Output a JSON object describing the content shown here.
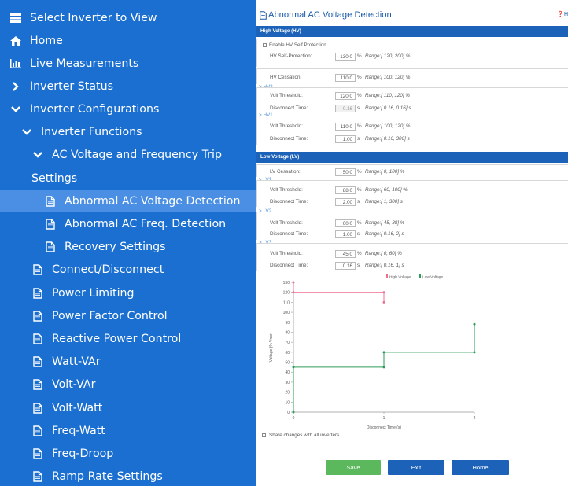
{
  "sidebar": {
    "items": [
      {
        "label": "Select Inverter to View",
        "icon": "list-icon"
      },
      {
        "label": "Home",
        "icon": "home-icon"
      },
      {
        "label": "Live Measurements",
        "icon": "bar-chart-icon"
      },
      {
        "label": "Inverter Status",
        "icon": "chevron-right-icon"
      },
      {
        "label": "Inverter Configurations",
        "icon": "chevron-down-icon"
      },
      {
        "label": "Inverter Functions",
        "icon": "chevron-down-icon"
      },
      {
        "label": "AC Voltage and Frequency Trip",
        "icon": "chevron-down-icon"
      },
      {
        "label": "Settings"
      },
      {
        "label": "Abnormal AC Voltage Detection",
        "icon": "document-icon",
        "active": true
      },
      {
        "label": "Abnormal AC Freq. Detection",
        "icon": "document-icon"
      },
      {
        "label": "Recovery Settings",
        "icon": "document-icon"
      },
      {
        "label": "Connect/Disconnect",
        "icon": "document-icon"
      },
      {
        "label": "Power Limiting",
        "icon": "document-icon"
      },
      {
        "label": "Power Factor Control",
        "icon": "document-icon"
      },
      {
        "label": "Reactive Power Control",
        "icon": "document-icon"
      },
      {
        "label": "Watt-VAr",
        "icon": "document-icon"
      },
      {
        "label": "Volt-VAr",
        "icon": "document-icon"
      },
      {
        "label": "Volt-Watt",
        "icon": "document-icon"
      },
      {
        "label": "Freq-Watt",
        "icon": "document-icon"
      },
      {
        "label": "Freq-Droop",
        "icon": "document-icon"
      },
      {
        "label": "Ramp Rate Settings",
        "icon": "document-icon"
      }
    ]
  },
  "page": {
    "title": "Abnormal AC Voltage Detection",
    "help_label": "H"
  },
  "hv": {
    "header": "High Voltage (HV)",
    "enable_label": "Enable HV Self Protection",
    "self_protection": {
      "label": "HV Self-Protection:",
      "value": "130.0",
      "unit": "%",
      "range": "Range:[ 120, 200] %"
    },
    "cessation": {
      "label": "HV Cessation:",
      "value": "110.0",
      "unit": "%",
      "range": "Range:[ 100, 120] %"
    },
    "hv2": {
      "name": "HV2",
      "threshold": {
        "label": "Volt Threshold:",
        "value": "120.0",
        "unit": "%",
        "range": "Range:[ 110, 120] %"
      },
      "time": {
        "label": "Disconnect Time:",
        "value": "0.16",
        "unit": "s",
        "range": "Range:[ 0.16, 0.16] s"
      }
    },
    "hv1": {
      "name": "HV1",
      "threshold": {
        "label": "Volt Threshold:",
        "value": "110.0",
        "unit": "%",
        "range": "Range:[ 100, 120] %"
      },
      "time": {
        "label": "Disconnect Time:",
        "value": "1.00",
        "unit": "s",
        "range": "Range:[ 0.16, 300] s"
      }
    }
  },
  "lv": {
    "header": "Low Voltage (LV)",
    "cessation": {
      "label": "LV Cessation:",
      "value": "50.0",
      "unit": "%",
      "range": "Range:[ 0, 100] %"
    },
    "lv1": {
      "name": "LV1",
      "threshold": {
        "label": "Volt Threshold:",
        "value": "88.0",
        "unit": "%",
        "range": "Range:[ 60, 100] %"
      },
      "time": {
        "label": "Disconnect Time:",
        "value": "2.00",
        "unit": "s",
        "range": "Range:[ 1, 300] s"
      }
    },
    "lv2": {
      "name": "LV2",
      "threshold": {
        "label": "Volt Threshold:",
        "value": "60.0",
        "unit": "%",
        "range": "Range:[ 45, 88] %"
      },
      "time": {
        "label": "Disconnect Time:",
        "value": "1.00",
        "unit": "s",
        "range": "Range:[ 0.16, 2] s"
      }
    },
    "lv3": {
      "name": "LV3",
      "threshold": {
        "label": "Volt Threshold:",
        "value": "45.0",
        "unit": "%",
        "range": "Range:[ 0, 60] %"
      },
      "time": {
        "label": "Disconnect Time:",
        "value": "0.16",
        "unit": "s",
        "range": "Range:[ 0.16, 1] s"
      }
    }
  },
  "chart_data": {
    "type": "line",
    "title": "",
    "xlabel": "Disconnect Time (s)",
    "ylabel": "Voltage (% Vnor)",
    "xlim": [
      0,
      2
    ],
    "ylim": [
      0,
      130
    ],
    "xticks": [
      0,
      1,
      2
    ],
    "yticks": [
      0,
      10,
      20,
      30,
      40,
      50,
      60,
      70,
      80,
      90,
      100,
      110,
      120,
      130
    ],
    "grid": false,
    "legend_position": "top-center",
    "series": [
      {
        "name": "High Voltage",
        "color": "#ef6f8f",
        "points": [
          [
            0,
            130
          ],
          [
            0,
            120
          ],
          [
            1,
            120
          ],
          [
            1,
            110
          ]
        ]
      },
      {
        "name": "Low Voltage",
        "color": "#2e9a5a",
        "points": [
          [
            0,
            0
          ],
          [
            0,
            45
          ],
          [
            1,
            45
          ],
          [
            1,
            60
          ],
          [
            2,
            60
          ],
          [
            2,
            88
          ]
        ]
      }
    ]
  },
  "footer": {
    "share_label": "Share changes with all inverters",
    "save_label": "Save",
    "exit_label": "Exit",
    "home_label": "Home",
    "save_color": "#5cb85c",
    "primary_color": "#1c62b8"
  }
}
